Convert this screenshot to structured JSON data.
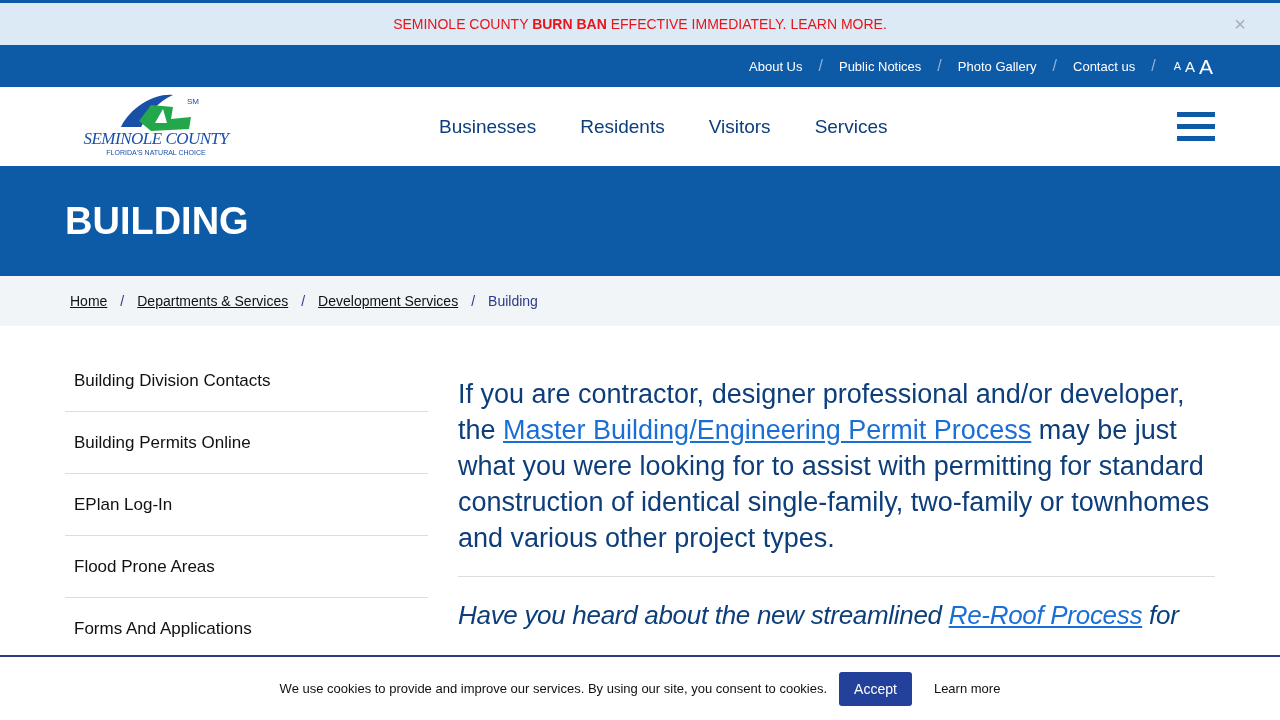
{
  "alert": {
    "before": "SEMINOLE COUNTY ",
    "bold": "BURN BAN",
    "after": " EFFECTIVE IMMEDIATELY. LEARN MORE.",
    "close": "×"
  },
  "utility_nav": {
    "separator": "/",
    "links": [
      "About Us",
      "Public Notices",
      "Photo Gallery",
      "Contact us"
    ],
    "text_sizes": [
      "A",
      "A",
      "A"
    ]
  },
  "logo": {
    "name": "SEMINOLE COUNTY",
    "tagline": "FLORIDA'S NATURAL CHOICE",
    "mark": "SM"
  },
  "main_nav": [
    "Businesses",
    "Residents",
    "Visitors",
    "Services"
  ],
  "page_title": "BUILDING",
  "breadcrumb": {
    "separator": "/",
    "items": [
      {
        "label": "Home",
        "current": false
      },
      {
        "label": "Departments & Services",
        "current": false
      },
      {
        "label": "Development Services",
        "current": false
      },
      {
        "label": "Building",
        "current": true
      }
    ]
  },
  "sidebar": [
    "Building Division Contacts",
    "Building Permits Online",
    "EPlan Log-In",
    "Flood Prone Areas",
    "Forms And Applications"
  ],
  "intro": {
    "before": "If you are contractor, designer professional and/or developer, the ",
    "link": "Master Building/Engineering Permit Process",
    "after": " may be just what you were looking for to assist with permitting for standard construction of identical single-family, two-family or townhomes and various other project types."
  },
  "question": {
    "before": "Have you heard about the new streamlined ",
    "link": "Re-Roof Process",
    "after": " for"
  },
  "cookie": {
    "text": "We use cookies to provide and improve our services. By using our site, you consent to cookies.",
    "accept": "Accept",
    "learn_more": "Learn more"
  }
}
